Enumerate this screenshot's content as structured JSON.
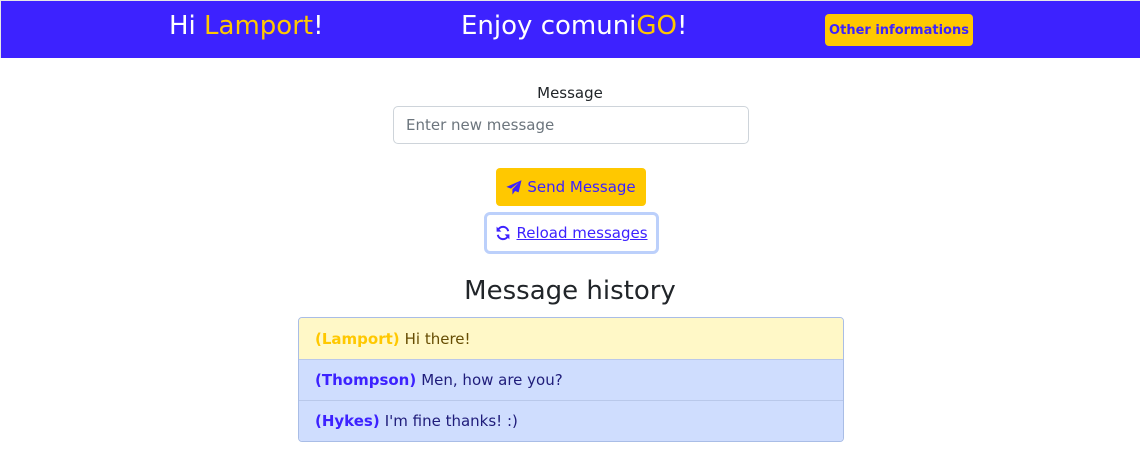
{
  "header": {
    "greeting_prefix": "Hi ",
    "user_name": "Lamport",
    "greeting_suffix": "!",
    "enjoy_prefix": "Enjoy comuni",
    "enjoy_highlight": "GO",
    "enjoy_suffix": "!",
    "other_button_label": "Other informations"
  },
  "form": {
    "message_label": "Message",
    "message_value": "",
    "message_placeholder": "Enter new message",
    "send_label": "Send Message",
    "send_icon": "paper-plane-icon",
    "reload_label": "Reload messages",
    "reload_icon": "refresh-icon"
  },
  "history": {
    "title": "Message history",
    "messages": [
      {
        "author": "(Lamport)",
        "text": "Hi there!",
        "own": true
      },
      {
        "author": "(Thompson)",
        "text": "Men, how are you?",
        "own": false
      },
      {
        "author": "(Hykes)",
        "text": "I'm fine thanks! :)",
        "own": false
      }
    ]
  },
  "colors": {
    "brand_blue": "#3d22ff",
    "accent_yellow": "#ffc800",
    "own_message_bg": "#fff8c7",
    "other_message_bg": "#cfddfe"
  }
}
